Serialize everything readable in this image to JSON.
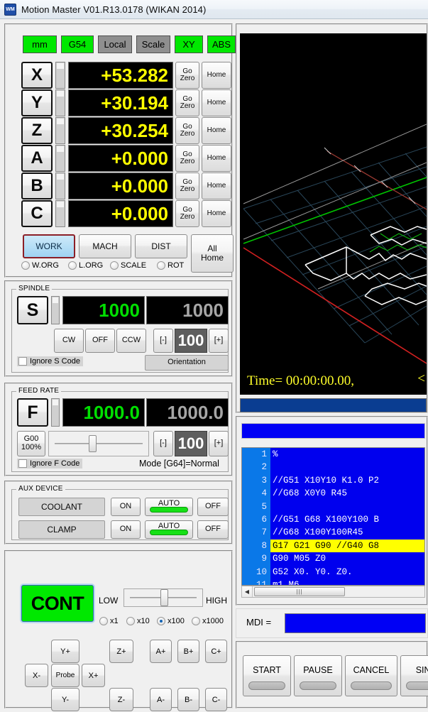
{
  "window": {
    "title": "Motion Master V01.R13.0178 (WIKAN 2014)",
    "icon": "wm-logo-icon",
    "icon_text": "WM"
  },
  "status_chips": [
    {
      "label": "mm",
      "state": "on"
    },
    {
      "label": "G54",
      "state": "on"
    },
    {
      "label": "Local",
      "state": "off"
    },
    {
      "label": "Scale",
      "state": "off"
    },
    {
      "label": "XY",
      "state": "on"
    },
    {
      "label": "ABS",
      "state": "on"
    }
  ],
  "axes": [
    {
      "name": "X",
      "value": "+53.282",
      "go_zero": "Go\nZero",
      "home": "Home"
    },
    {
      "name": "Y",
      "value": "+30.194",
      "go_zero": "Go\nZero",
      "home": "Home"
    },
    {
      "name": "Z",
      "value": "+30.254",
      "go_zero": "Go\nZero",
      "home": "Home"
    },
    {
      "name": "A",
      "value": "+0.000",
      "go_zero": "Go\nZero",
      "home": "Home"
    },
    {
      "name": "B",
      "value": "+0.000",
      "go_zero": "Go\nZero",
      "home": "Home"
    },
    {
      "name": "C",
      "value": "+0.000",
      "go_zero": "Go\nZero",
      "home": "Home"
    }
  ],
  "coord_modes": {
    "work": "WORK",
    "mach": "MACH",
    "dist": "DIST",
    "all_home": "All\nHome",
    "selected": "WORK"
  },
  "coord_flags": [
    {
      "label": "W.ORG",
      "checked": false
    },
    {
      "label": "L.ORG",
      "checked": false
    },
    {
      "label": "SCALE",
      "checked": false
    },
    {
      "label": "ROT",
      "checked": false
    }
  ],
  "spindle": {
    "group_label": "SPINDLE",
    "letter": "S",
    "actual": "1000",
    "commanded": "1000",
    "cw": "CW",
    "off": "OFF",
    "ccw": "CCW",
    "minus": "[-]",
    "override": "100",
    "plus": "[+]",
    "ignore_label": "Ignore S Code",
    "ignore_checked": false,
    "orientation": "Orientation"
  },
  "feed": {
    "group_label": "FEED RATE",
    "letter": "F",
    "actual": "1000.0",
    "commanded": "1000.0",
    "rapid_label": "G00\n100%",
    "minus": "[-]",
    "override": "100",
    "plus": "[+]",
    "ignore_label": "Ignore F Code",
    "ignore_checked": false,
    "mode_text": "Mode [G64]=Normal",
    "slider_pct": 42
  },
  "aux": {
    "group_label": "AUX DEVICE",
    "rows": [
      {
        "name": "COOLANT",
        "on": "ON",
        "auto": "AUTO",
        "off": "OFF",
        "auto_active": true
      },
      {
        "name": "CLAMP",
        "on": "ON",
        "auto": "AUTO",
        "off": "OFF",
        "auto_active": true
      }
    ]
  },
  "jog": {
    "mode_button": "CONT",
    "low_label": "LOW",
    "high_label": "HIGH",
    "speed_pct": 50,
    "steps": [
      {
        "label": "x1",
        "checked": false
      },
      {
        "label": "x10",
        "checked": false
      },
      {
        "label": "x100",
        "checked": true
      },
      {
        "label": "x1000",
        "checked": false
      }
    ],
    "buttons": {
      "y_plus": "Y+",
      "y_minus": "Y-",
      "x_plus": "X+",
      "x_minus": "X-",
      "probe": "Probe",
      "z_plus": "Z+",
      "z_minus": "Z-",
      "a_plus": "A+",
      "a_minus": "A-",
      "b_plus": "B+",
      "b_minus": "B-",
      "c_plus": "C+",
      "c_minus": "C-"
    }
  },
  "viewport": {
    "time_label": "Time= 00:00:00.00,",
    "chevron": "<",
    "bg": "#000000",
    "axis_x_color": "#d02020",
    "axis_y_color": "#00c000",
    "grid_color": "#2c4a5e",
    "toolpath_color": "#ffffff"
  },
  "editor": {
    "lines": [
      {
        "n": "1",
        "text": "%",
        "hl": false
      },
      {
        "n": "2",
        "text": "",
        "hl": false
      },
      {
        "n": "3",
        "text": "//G51 X10Y10 K1.0 P2",
        "hl": false
      },
      {
        "n": "4",
        "text": "//G68 X0Y0 R45",
        "hl": false
      },
      {
        "n": "5",
        "text": "",
        "hl": false
      },
      {
        "n": "6",
        "text": "//G51 G68 X100Y100 B",
        "hl": false
      },
      {
        "n": "7",
        "text": "//G68 X100Y100R45",
        "hl": false
      },
      {
        "n": "8",
        "text": "G17 G21 G90 //G40 G8",
        "hl": true
      },
      {
        "n": "9",
        "text": "G90 M05 Z0",
        "hl": false
      },
      {
        "n": "10",
        "text": "G52 X0. Y0. Z0.",
        "hl": false
      },
      {
        "n": "11",
        "text": "m1 M6",
        "hl": false
      }
    ],
    "hscroll_grip": "|||",
    "hscroll_left_arrow": "◀"
  },
  "mdi": {
    "label": "MDI  =",
    "value": "",
    "placeholder": ""
  },
  "run_buttons": [
    {
      "label": "START"
    },
    {
      "label": "PAUSE"
    },
    {
      "label": "CANCEL"
    },
    {
      "label": "SING"
    }
  ],
  "colors": {
    "chip_on": "#00e800",
    "chip_off": "#8f8f8f",
    "lcd_yellow": "#ffff00",
    "lcd_green": "#00e000",
    "lcd_gray": "#a6a6a6",
    "editor_bg": "#0000ee",
    "editor_gutter": "#0a78e8",
    "highlight": "#ffff00",
    "bar_blue": "#0000f5",
    "bar_navy": "#0a3d91",
    "select_border": "#8b1f27"
  }
}
